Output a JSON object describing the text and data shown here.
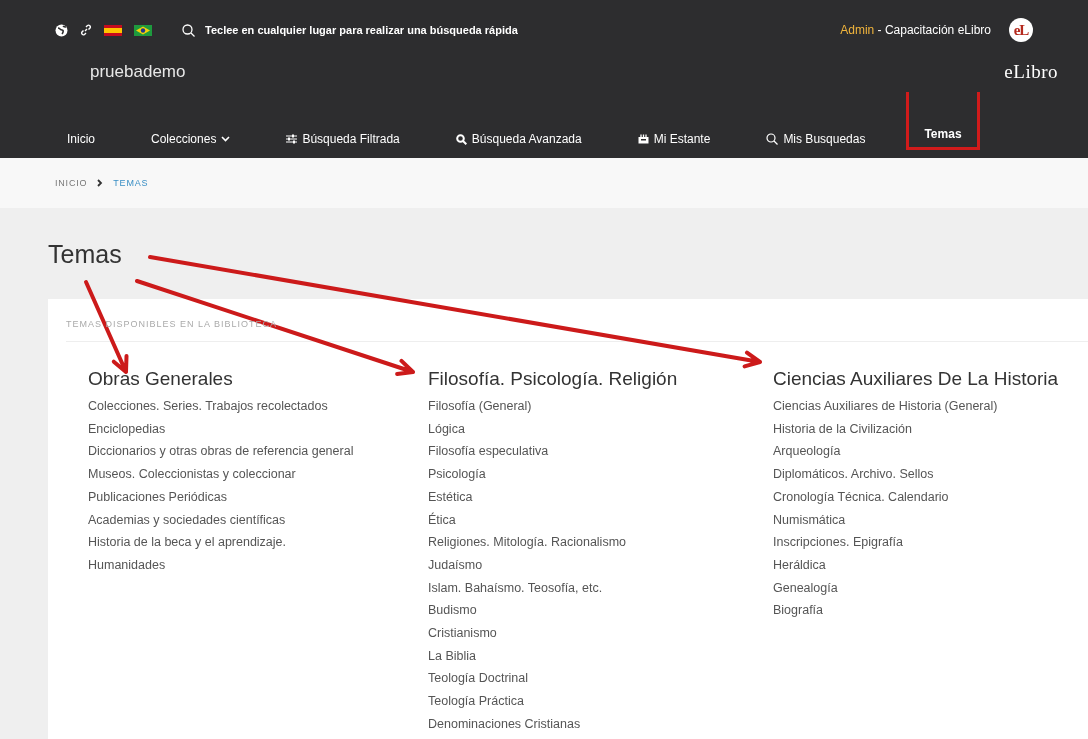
{
  "top_bar": {
    "search": {
      "placeholder": "Teclee en cualquier lugar para realizar una búsqueda rápida"
    },
    "user": {
      "role": "Admin",
      "separator": " - ",
      "name": "Capacitación eLibro"
    },
    "avatar": "eL"
  },
  "brand": {
    "site": "pruebademo",
    "logo": "eLibro"
  },
  "nav": [
    {
      "label": "Inicio",
      "kind": "plain",
      "selected": false,
      "highlighted": false
    },
    {
      "label": "Colecciones",
      "kind": "dropdown",
      "selected": false,
      "highlighted": false
    },
    {
      "label": "Búsqueda Filtrada",
      "kind": "filter",
      "selected": false,
      "highlighted": false
    },
    {
      "label": "Búsqueda Avanzada",
      "kind": "advanced",
      "selected": false,
      "highlighted": false
    },
    {
      "label": "Mi Estante",
      "kind": "shelf",
      "selected": false,
      "highlighted": false
    },
    {
      "label": "Mis Busquedas",
      "kind": "history",
      "selected": false,
      "highlighted": false
    },
    {
      "label": "Temas",
      "kind": "plain",
      "selected": true,
      "highlighted": true
    }
  ],
  "breadcrumb": [
    {
      "label": "INICIO",
      "selected": false
    },
    {
      "label": "TEMAS",
      "selected": true
    }
  ],
  "page_title": "Temas",
  "card": {
    "subtitle": "TEMAS DISPONIBLES EN LA BIBLIOTECA",
    "columns": [
      {
        "title": "Obras Generales",
        "items": [
          "Colecciones. Series. Trabajos recolectados",
          "Enciclopedias",
          "Diccionarios y otras obras de referencia general",
          "Museos. Coleccionistas y coleccionar",
          "Publicaciones Periódicas",
          "Academias y sociedades científicas",
          "Historia de la beca y el aprendizaje.",
          "Humanidades"
        ]
      },
      {
        "title": "Filosofía. Psicología. Religión",
        "items": [
          "Filosofía (General)",
          "Lógica",
          "Filosofía especulativa",
          "Psicología",
          "Estética",
          "Ética",
          "Religiones. Mitología. Racionalismo",
          "Judaísmo",
          "Islam. Bahaísmo. Teosofía, etc.",
          "Budismo",
          "Cristianismo",
          "La Biblia",
          "Teología Doctrinal",
          "Teología Práctica",
          "Denominaciones Cristianas"
        ]
      },
      {
        "title": "Ciencias Auxiliares De La Historia",
        "items": [
          "Ciencias Auxiliares de Historia (General)",
          "Historia de la Civilización",
          "Arqueología",
          "Diplomáticos. Archivo. Sellos",
          "Cronología Técnica. Calendario",
          "Numismática",
          "Inscripciones. Epigrafía",
          "Heráldica",
          "Genealogía",
          "Biografía"
        ]
      }
    ]
  }
}
